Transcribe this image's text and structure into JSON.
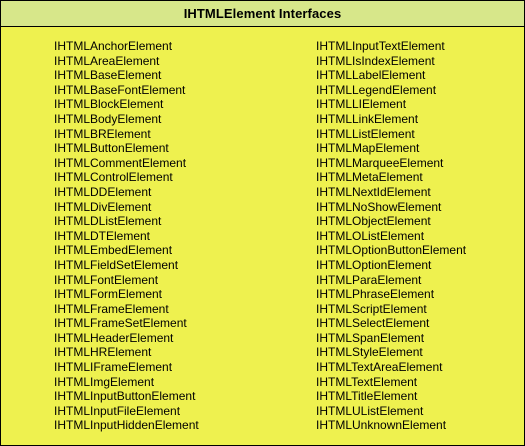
{
  "header": {
    "title": "IHTMLElement Interfaces"
  },
  "columns": {
    "left": [
      "IHTMLAnchorElement",
      "IHTMLAreaElement",
      "IHTMLBaseElement",
      "IHTMLBaseFontElement",
      "IHTMLBlockElement",
      "IHTMLBodyElement",
      "IHTMLBRElement",
      "IHTMLButtonElement",
      "IHTMLCommentElement",
      "IHTMLControlElement",
      "IHTMLDDElement",
      "IHTMLDivElement",
      "IHTMLDListElement",
      "IHTMLDTElement",
      "IHTMLEmbedElement",
      "IHTMLFieldSetElement",
      "IHTMLFontElement",
      "IHTMLFormElement",
      "IHTMLFrameElement",
      "IHTMLFrameSetElement",
      "IHTMLHeaderElement",
      "IHTMLHRElement",
      "IHTMLIFrameElement",
      "IHTMLImgElement",
      "IHTMLInputButtonElement",
      "IHTMLInputFileElement",
      "IHTMLInputHiddenElement"
    ],
    "right": [
      "IHTMLInputTextElement",
      "IHTMLIsIndexElement",
      "IHTMLLabelElement",
      "IHTMLLegendElement",
      "IHTMLLIElement",
      "IHTMLLinkElement",
      "IHTMLListElement",
      "IHTMLMapElement",
      "IHTMLMarqueeElement",
      "IHTMLMetaElement",
      "IHTMLNextIdElement",
      "IHTMLNoShowElement",
      "IHTMLObjectElement",
      "IHTMLOListElement",
      "IHTMLOptionButtonElement",
      "IHTMLOptionElement",
      "IHTMLParaElement",
      "IHTMLPhraseElement",
      "IHTMLScriptElement",
      "IHTMLSelectElement",
      "IHTMLSpanElement",
      "IHTMLStyleElement",
      "IHTMLTextAreaElement",
      "IHTMLTextElement",
      "IHTMLTitleElement",
      "IHTMLUListElement",
      "IHTMLUnknownElement"
    ]
  },
  "colors": {
    "body_background": "#eef14f",
    "header_background": "#d7e78a",
    "border": "#000000",
    "text": "#000000"
  }
}
